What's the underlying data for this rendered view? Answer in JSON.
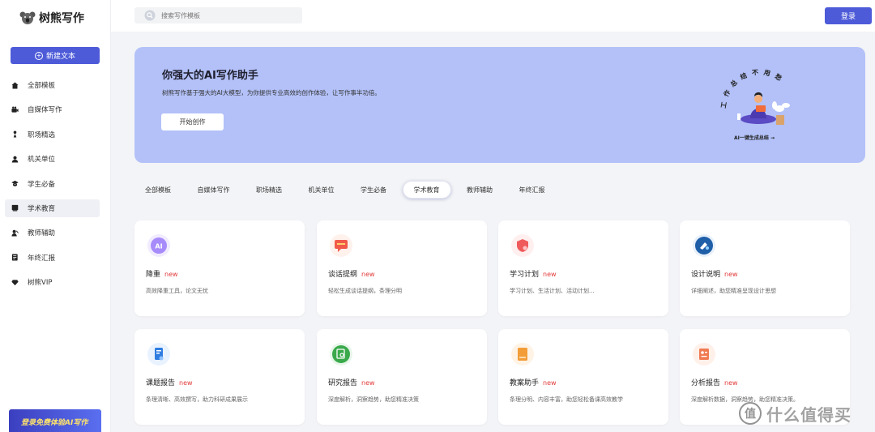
{
  "app": {
    "name": "树熊写作"
  },
  "sidebar": {
    "new_button": "新建文本",
    "items": [
      {
        "label": "全部模板",
        "icon": "home-icon"
      },
      {
        "label": "自媒体写作",
        "icon": "camera-icon"
      },
      {
        "label": "职场精选",
        "icon": "tie-icon"
      },
      {
        "label": "机关单位",
        "icon": "person-icon"
      },
      {
        "label": "学生必备",
        "icon": "graduation-cap-icon"
      },
      {
        "label": "学术教育",
        "icon": "book-icon",
        "active": true
      },
      {
        "label": "教师辅助",
        "icon": "teacher-icon"
      },
      {
        "label": "年终汇报",
        "icon": "report-icon"
      },
      {
        "label": "树熊VIP",
        "icon": "diamond-icon"
      }
    ],
    "promo": "登录免费体验AI写作"
  },
  "topbar": {
    "search_placeholder": "搜索写作模板",
    "login_label": "登录"
  },
  "hero": {
    "title": "你强大的AI写作助手",
    "subtitle": "树熊写作基于强大的AI大模型，为你提供专业高效的创作体验，让写作事半功倍。",
    "button": "开始创作",
    "art_text": "工作总结不用愁",
    "art_caption": "AI一键生成总结 →"
  },
  "tabs": [
    "全部模板",
    "自媒体写作",
    "职场精选",
    "机关单位",
    "学生必备",
    "学术教育",
    "教师辅助",
    "年终汇报"
  ],
  "active_tab": "学术教育",
  "cards": [
    {
      "title": "降重",
      "badge": "new",
      "desc": "高效降重工具，论文无忧",
      "icon": "ai-icon",
      "color": "#a78bfa",
      "bg": "#f1ebff"
    },
    {
      "title": "谈话提纲",
      "badge": "new",
      "desc": "轻松生成谈话提纲，条理分明",
      "icon": "chat-icon",
      "color": "#f15a4a",
      "bg": "#fff1ec"
    },
    {
      "title": "学习计划",
      "badge": "new",
      "desc": "学习计划、生活计划、活动计划...",
      "icon": "shield-icon",
      "color": "#ef5b5b",
      "bg": "#ffefef"
    },
    {
      "title": "设计说明",
      "badge": "new",
      "desc": "详细阐述，助您精准呈现设计思想",
      "icon": "design-icon",
      "color": "#1f5fa8",
      "bg": "#e8f0fa"
    },
    {
      "title": "课题报告",
      "badge": "new",
      "desc": "条理清晰、高效撰写，助力科研成果展示",
      "icon": "document-icon",
      "color": "#2f7de1",
      "bg": "#e9f2ff"
    },
    {
      "title": "研究报告",
      "badge": "new",
      "desc": "深度解析，洞察趋势，助您精准决策",
      "icon": "research-icon",
      "color": "#3aa94b",
      "bg": "#e8f6ea"
    },
    {
      "title": "教案助手",
      "badge": "new",
      "desc": "条理分明、内容丰富，助您轻松备课高效教学",
      "icon": "notebook-icon",
      "color": "#f29d38",
      "bg": "#fff3e6"
    },
    {
      "title": "分析报告",
      "badge": "new",
      "desc": "深度解析数据，洞察趋势，助您精准决策。",
      "icon": "analysis-icon",
      "color": "#f07b52",
      "bg": "#fff0ea"
    }
  ],
  "watermark": {
    "symbol": "值",
    "text": "什么值得买"
  }
}
